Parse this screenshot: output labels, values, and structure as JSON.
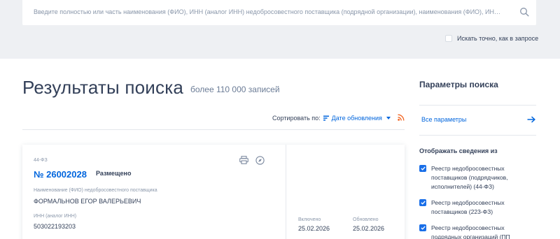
{
  "search": {
    "placeholder": "Введите полностью или часть наименования (ФИО), ИНН (аналог ИНН) недобросовестного поставщика (подрядной организации), наименования (ФИО), ИНН учредит...",
    "exact_label": "Искать точно, как в запросе"
  },
  "results": {
    "title": "Результаты поиска",
    "count": "более 110 000 записей",
    "sort_label": "Сортировать по:",
    "sort_value": "Дате обновления"
  },
  "card": {
    "law": "44-ФЗ",
    "number": "№ 26002028",
    "status": "Размещено",
    "supplier_label": "Наименование (ФИО) недобросовестного поставщика",
    "supplier_value": "ФОРМАЛЬНОВ ЕГОР ВАЛЕРЬЕВИЧ",
    "inn_label": "ИНН (аналог ИНН)",
    "inn_value": "503022193203",
    "included_label": "Включено",
    "included_value": "25.02.2026",
    "updated_label": "Обновлено",
    "updated_value": "25.02.2026"
  },
  "params": {
    "title": "Параметры поиска",
    "all_params": "Все параметры",
    "show_title": "Отображать сведения из",
    "registries": [
      {
        "label": "Реестр недобросовестных поставщиков (подрядчиков, исполнителей) (44-ФЗ)",
        "checked": true
      },
      {
        "label": "Реестр недобросовестных поставщиков (223-ФЗ)",
        "checked": true
      },
      {
        "label": "Реестр недобросовестных подрядных организаций (ПП",
        "checked": true
      }
    ]
  },
  "colors": {
    "accent": "#0065dd",
    "text": "#334059",
    "muted": "#8a97aa",
    "band": "#eef0f3",
    "rss": "#f26522"
  }
}
